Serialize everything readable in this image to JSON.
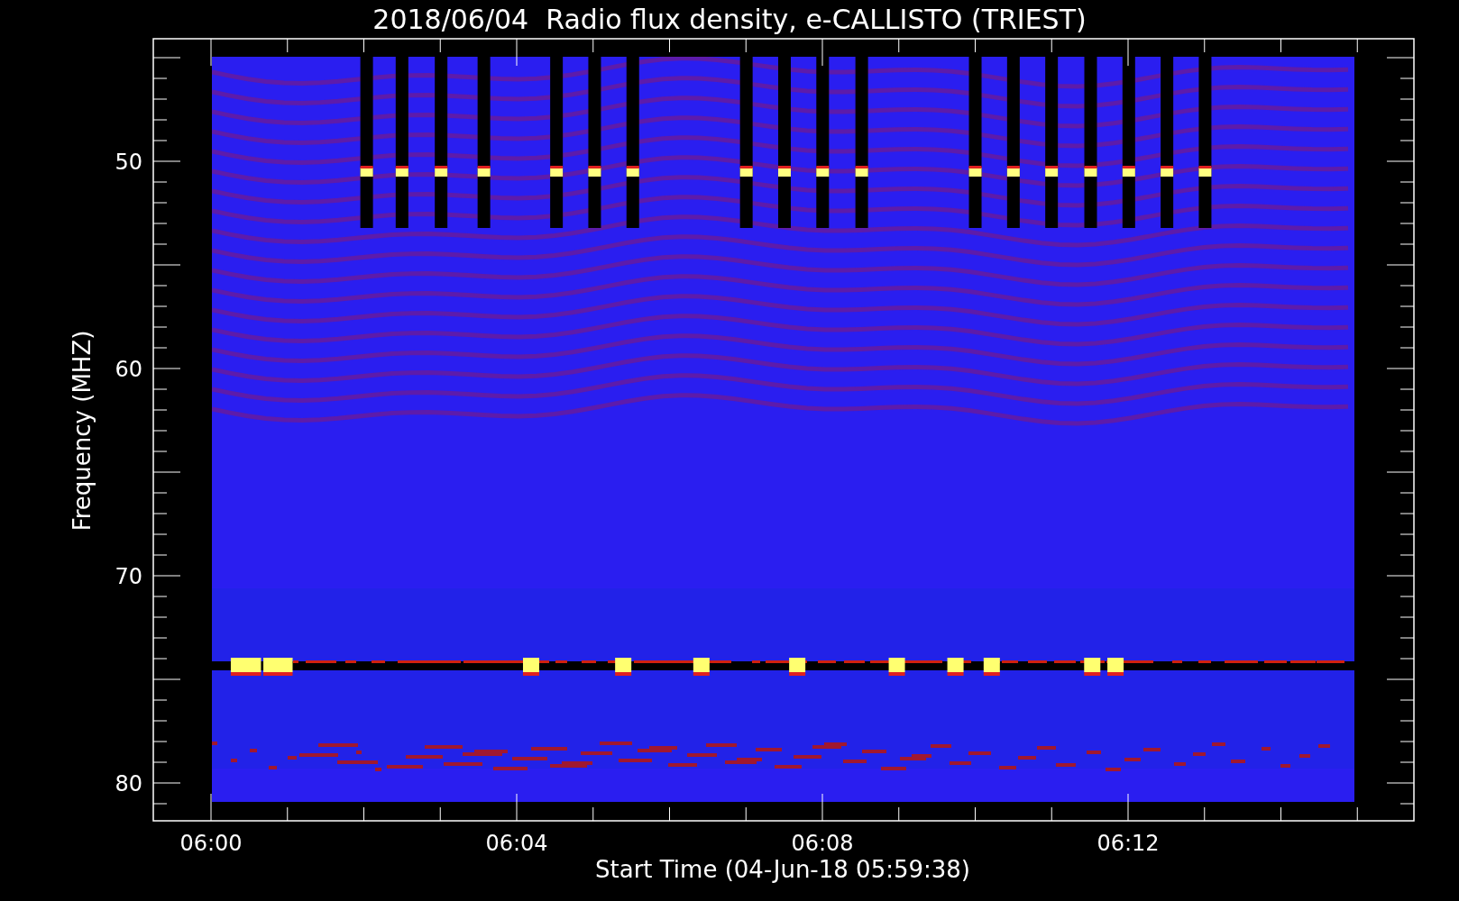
{
  "title": "2018/06/04  Radio flux density, e-CALLISTO (TRIEST)",
  "y_axis": {
    "label": "Frequency (MHZ)",
    "ticks": [
      "50",
      "60",
      "70",
      "80"
    ]
  },
  "x_axis": {
    "label": "Start Time (04-Jun-18 05:59:38)",
    "ticks": [
      "06:00",
      "06:04",
      "06:08",
      "06:12"
    ]
  }
}
